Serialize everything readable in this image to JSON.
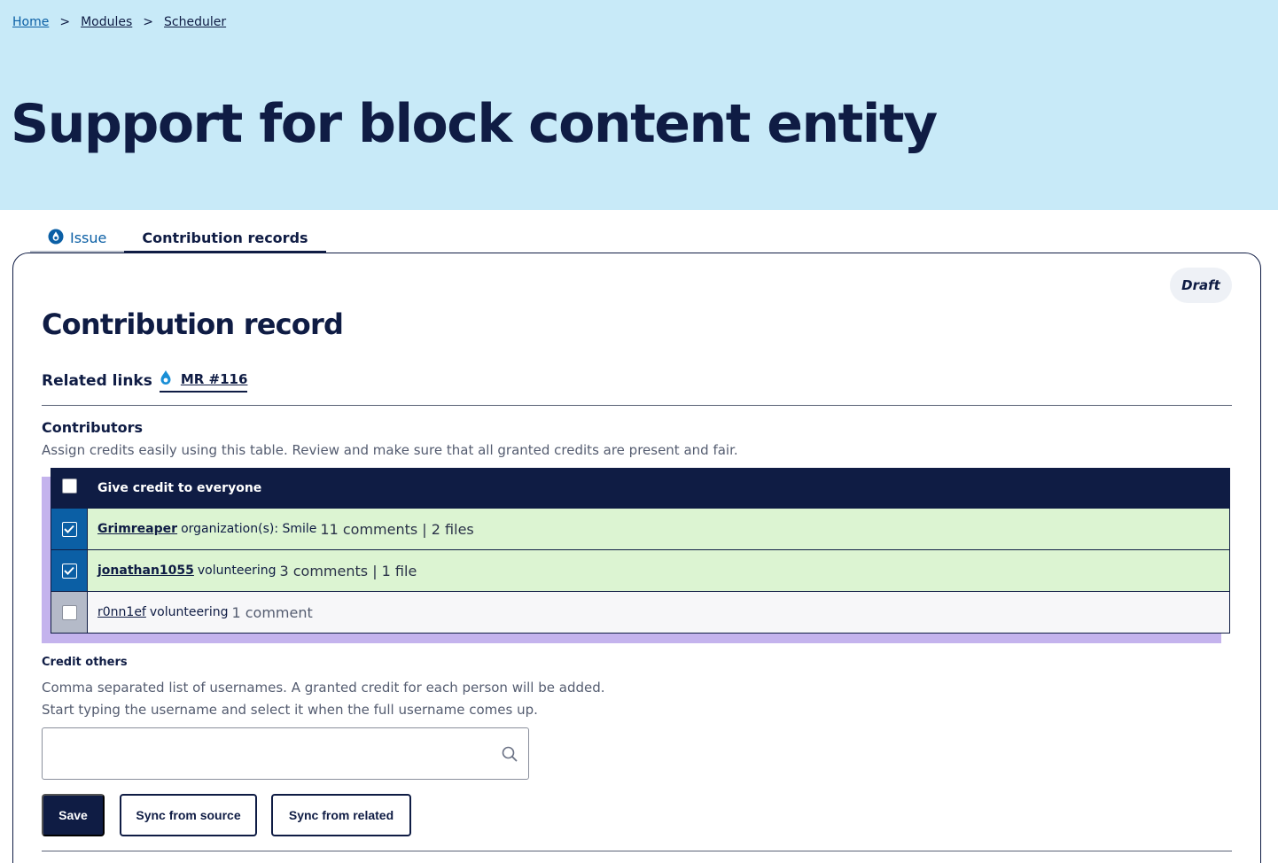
{
  "breadcrumb": {
    "home": "Home",
    "modules": "Modules",
    "scheduler": "Scheduler",
    "sep1": ">",
    "sep2": ">"
  },
  "page": {
    "title": "Support for block content entity"
  },
  "tabs": {
    "issue": "Issue",
    "contribution_records": "Contribution records",
    "active": "Contribution records"
  },
  "record": {
    "status_badge": "Draft",
    "title": "Contribution record",
    "related_links_label": "Related links",
    "related_link": "MR #116"
  },
  "contributors": {
    "title": "Contributors",
    "description": "Assign credits easily using this table. Review and make sure that all granted credits are present and fair.",
    "give_all_label": "Give credit to everyone",
    "give_all_checked": false,
    "rows": [
      {
        "username": "Grimreaper",
        "role": "organization(s): Smile",
        "stats": "11 comments | 2 files",
        "checked": true
      },
      {
        "username": "jonathan1055",
        "role": "volunteering",
        "stats": "3 comments | 1 file",
        "checked": true
      },
      {
        "username": "r0nn1ef",
        "role": "volunteering",
        "stats": "1 comment",
        "checked": false
      }
    ]
  },
  "credit_others": {
    "title": "Credit others",
    "description_line1": "Comma separated list of usernames. A granted credit for each person will be added.",
    "description_line2": "Start typing the username and select it when the full username comes up.",
    "value": "",
    "placeholder": ""
  },
  "actions": {
    "save": "Save",
    "sync_source": "Sync from source",
    "sync_related": "Sync from related"
  },
  "icons": {
    "issue_tab": "drupal-drop-icon",
    "related_link": "drupal-drop-icon",
    "credit_input": "search-icon",
    "checkbox": "check-icon"
  },
  "colors": {
    "hero_bg": "#c8eaf8",
    "navy": "#0f1c44",
    "link_blue": "#0b5fa5",
    "credited_row": "#dcf4d2",
    "purple_accent": "#c4b3ed"
  }
}
